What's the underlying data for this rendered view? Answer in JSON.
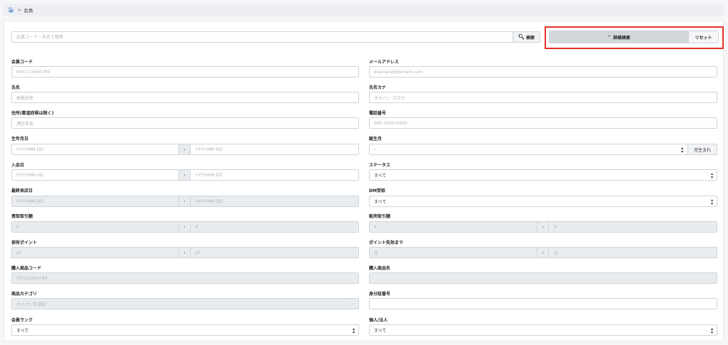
{
  "breadcrumb": {
    "current": "会員"
  },
  "search": {
    "placeholder": "会員コード・氏名で検索",
    "button": "検索",
    "advanced": "詳細検索",
    "reset": "リセット"
  },
  "fields": {
    "member_code": {
      "label": "会員コード",
      "placeholder": "M00123456789"
    },
    "email": {
      "label": "メールアドレス",
      "placeholder": "example@domain.com"
    },
    "name": {
      "label": "氏名",
      "placeholder": "高橋太郎"
    },
    "name_kana": {
      "label": "氏名カナ",
      "placeholder": "タカハシ タロウ"
    },
    "address": {
      "label": "住所(都道府県は除く)",
      "placeholder": "港区赤坂"
    },
    "phone": {
      "label": "電話番号",
      "placeholder": "090-0000-0000"
    },
    "birthdate": {
      "label": "生年月日",
      "from": "YYYY-MM-DD",
      "to": "YYYY-MM-DD"
    },
    "birth_month": {
      "label": "誕生月",
      "value": "-",
      "suffix": "月生まれ"
    },
    "join_date": {
      "label": "入会日",
      "from": "YYYY-MM-DD",
      "to": "YYYY-MM-DD"
    },
    "status": {
      "label": "ステータス",
      "value": "すべて"
    },
    "last_visit": {
      "label": "最終来店日",
      "from": "YYYY-MM-DD",
      "to": "YYYY-MM-DD"
    },
    "dm": {
      "label": "DM受取",
      "value": "すべて"
    },
    "purchase_amount": {
      "label": "買取取引額",
      "from": "¥",
      "to": "¥"
    },
    "sales_amount": {
      "label": "販売取引額",
      "from": "¥",
      "to": "¥"
    },
    "points": {
      "label": "保有ポイント",
      "from": "pt",
      "to": "pt"
    },
    "points_expiry": {
      "label": "ポイント失効まで",
      "from": "日",
      "to": "日"
    },
    "product_code": {
      "label": "購入商品コード",
      "placeholder": "IT0123456789"
    },
    "product_name": {
      "label": "購入商品名",
      "placeholder": ""
    },
    "category": {
      "label": "商品カテゴリ",
      "placeholder": "カテゴリを選択"
    },
    "id_number": {
      "label": "身分証番号",
      "placeholder": ""
    },
    "rank": {
      "label": "会員ランク",
      "value": "すべて"
    },
    "entity": {
      "label": "個人/法人",
      "value": "すべて"
    }
  },
  "icons": {
    "home": "home-icon",
    "search": "search-icon",
    "range": "chevron-right-icon"
  },
  "colors": {
    "highlight": "#e5302a",
    "link": "#3a7bd5"
  }
}
